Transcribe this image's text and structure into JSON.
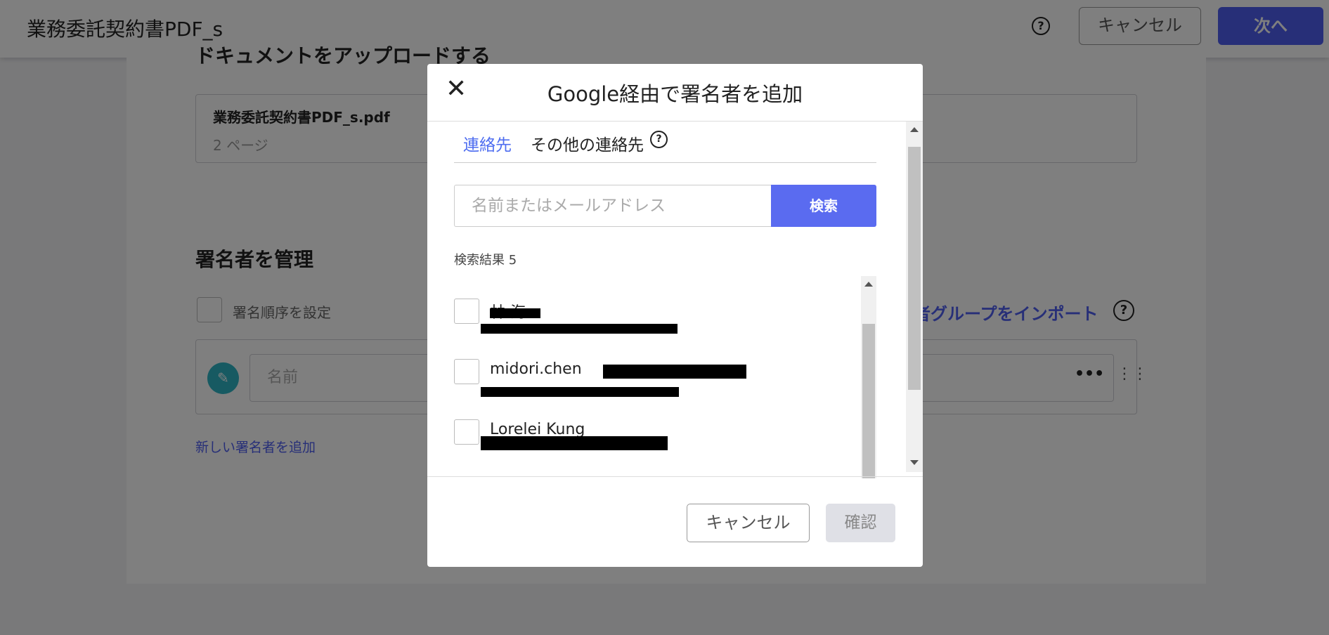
{
  "header": {
    "doc_title": "業務委託契約書PDF_s",
    "help_icon": "?",
    "cancel_label": "キャンセル",
    "next_label": "次へ"
  },
  "upload": {
    "heading": "ドキュメントをアップロードする",
    "file_name": "業務委託契約書PDF_s.pdf",
    "file_pages": "2 ページ"
  },
  "signers": {
    "heading": "署名者を管理",
    "order_label": "署名順序を設定",
    "import_link": "者グループをインポート",
    "name_placeholder": "名前",
    "more_icon": "•••",
    "drag_icon": "⋮⋮",
    "add_link": "新しい署名者を追加"
  },
  "modal": {
    "title": "Google経由で署名者を追加",
    "close_icon": "✕",
    "tabs": [
      {
        "label": "連絡先",
        "active": true
      },
      {
        "label": "その他の連絡先",
        "active": false
      }
    ],
    "tab_help_icon": "?",
    "search_placeholder": "名前またはメールアドレス",
    "search_button": "検索",
    "results_label": "検索結果 5",
    "results": [
      {
        "name": "林 海"
      },
      {
        "name": "midori.chen"
      },
      {
        "name": "Lorelei Kung"
      }
    ],
    "cancel_label": "キャンセル",
    "confirm_label": "確認"
  },
  "colors": {
    "accent": "#4f5ef0",
    "avatar": "#2fb5c4",
    "overlay": "rgba(0,0,0,0.5)"
  }
}
